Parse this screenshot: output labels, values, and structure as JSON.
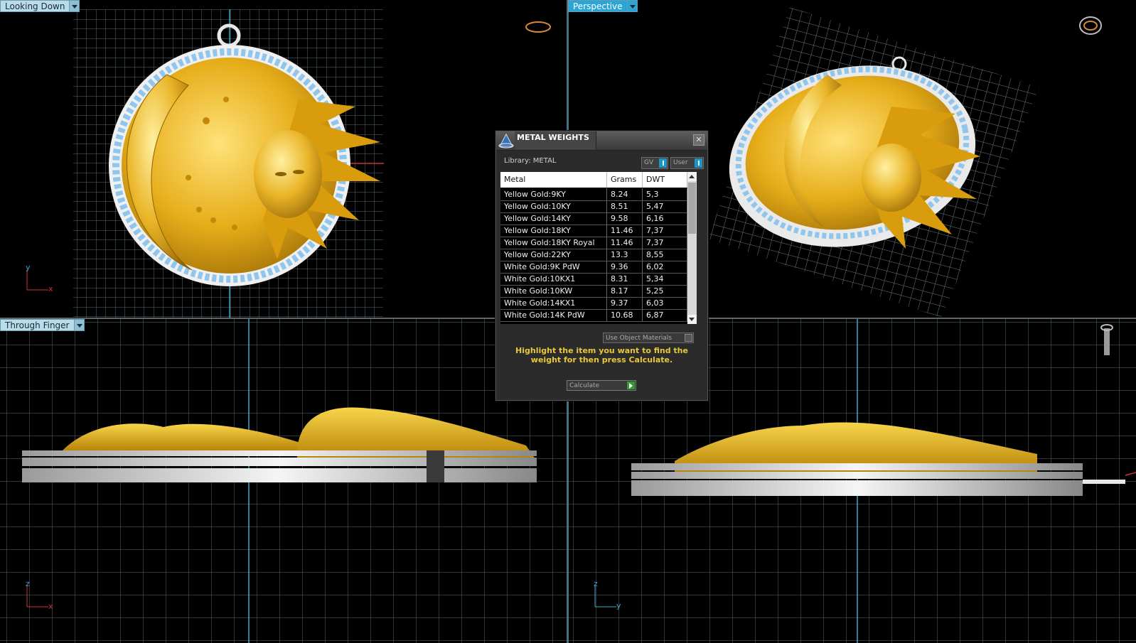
{
  "viewports": {
    "top_left": {
      "label": "Looking Down",
      "axes": [
        "y",
        "x"
      ]
    },
    "top_right": {
      "label": "Perspective"
    },
    "bottom_left": {
      "label": "Through Finger",
      "axes": [
        "z",
        "x"
      ]
    },
    "bottom_right": {
      "axes": [
        "z",
        "y"
      ]
    }
  },
  "dialog": {
    "title": "METAL WEIGHTS",
    "close": "✕",
    "library_label": "Library: METAL",
    "gv_label": "GV",
    "user_label": "User",
    "columns": [
      "Metal",
      "Grams",
      "DWT"
    ],
    "rows": [
      {
        "metal": "Yellow Gold:9KY",
        "grams": "8.24",
        "dwt": "5,3"
      },
      {
        "metal": "Yellow Gold:10KY",
        "grams": "8.51",
        "dwt": "5,47"
      },
      {
        "metal": "Yellow Gold:14KY",
        "grams": "9.58",
        "dwt": "6,16"
      },
      {
        "metal": "Yellow Gold:18KY",
        "grams": "11.46",
        "dwt": "7,37"
      },
      {
        "metal": "Yellow Gold:18KY Royal",
        "grams": "11.46",
        "dwt": "7,37"
      },
      {
        "metal": "Yellow Gold:22KY",
        "grams": "13.3",
        "dwt": "8,55"
      },
      {
        "metal": "White Gold:9K PdW",
        "grams": "9.36",
        "dwt": "6,02"
      },
      {
        "metal": "White Gold:10KX1",
        "grams": "8.31",
        "dwt": "5,34"
      },
      {
        "metal": "White Gold:10KW",
        "grams": "8.17",
        "dwt": "5,25"
      },
      {
        "metal": "White Gold:14KX1",
        "grams": "9.37",
        "dwt": "6,03"
      },
      {
        "metal": "White Gold:14K PdW",
        "grams": "10.68",
        "dwt": "6,87"
      }
    ],
    "use_object_materials": "Use Object Materials",
    "instruction": "Highlight the item you want to find the weight for then press Calculate.",
    "calculate_label": "Calculate"
  },
  "colors": {
    "gold": "#e0a812",
    "gold_light": "#f7d54a",
    "gem_blue": "#8fc6ee",
    "grid": "#5c6b73",
    "accent": "#2aa6d6"
  }
}
